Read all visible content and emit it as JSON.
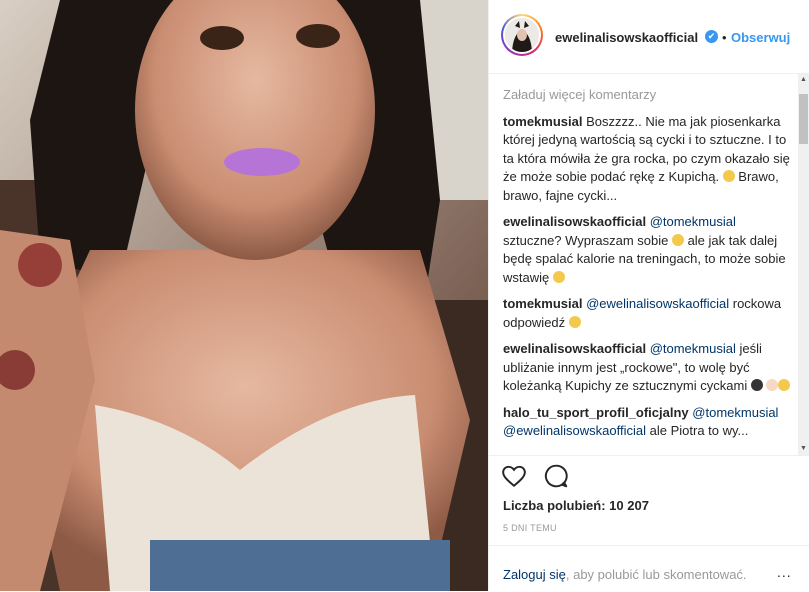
{
  "post": {
    "username": "ewelinalisowskaofficial",
    "verified_mark": "✔",
    "separator": "•",
    "follow_label": "Obserwuj"
  },
  "comments_section": {
    "load_more": "Załaduj więcej komentarzy",
    "comments": [
      {
        "author": "tomekmusial",
        "parts": [
          {
            "t": "Boszzzz.. Nie ma jak piosenkarka której jedyną wartością są cycki i to sztuczne. I to ta która mówiła że gra rocka, po czym okazało się że może sobie podać rękę z Kupichą. "
          },
          {
            "emoji": "clapping-hands-emoji",
            "color": "#f2c94c"
          },
          {
            "t": " Brawo, brawo, fajne cycki..."
          }
        ]
      },
      {
        "author": "ewelinalisowskaofficial",
        "parts": [
          {
            "mention": "@tomekmusial"
          },
          {
            "t": " sztuczne? Wypraszam sobie "
          },
          {
            "emoji": "laughing-emoji",
            "color": "#f2c94c"
          },
          {
            "t": " ale jak tak dalej będę spalać kalorie na treningach, to może sobie wstawię "
          },
          {
            "emoji": "winking-tongue-emoji",
            "color": "#f2c94c"
          }
        ]
      },
      {
        "author": "tomekmusial",
        "parts": [
          {
            "mention": "@ewelinalisowskaofficial"
          },
          {
            "t": " rockowa odpowiedź "
          },
          {
            "emoji": "eye-roll-emoji",
            "color": "#f2c94c"
          }
        ]
      },
      {
        "author": "ewelinalisowskaofficial",
        "parts": [
          {
            "mention": "@tomekmusial"
          },
          {
            "t": " jeśli ubliżanie innym jest „rockowe\", to wolę być koleżanką Kupichy ze sztucznymi cyckami "
          },
          {
            "emoji": "victory-hand-emoji",
            "color": "#333333"
          },
          {
            "t": " "
          },
          {
            "emoji": "skin-tone-emoji",
            "color": "#f5d9c4"
          },
          {
            "emoji": "sunglasses-emoji",
            "color": "#f2c94c"
          }
        ]
      },
      {
        "author": "halo_tu_sport_profil_oficjalny",
        "parts": [
          {
            "mention": "@tomekmusial"
          },
          {
            "t": " "
          },
          {
            "mention": "@ewelinalisowskaofficial"
          },
          {
            "t": " ale Piotra to wy..."
          }
        ]
      }
    ]
  },
  "actions": {
    "heart_icon": "heart-outline",
    "comment_icon": "speech-bubble-outline"
  },
  "likes_text": "Liczba polubień: 10 207",
  "timestamp": "5 DNI TEMU",
  "footer": {
    "login_label": "Zaloguj się",
    "prompt": ", aby polubić lub skomentować.",
    "more_label": "..."
  },
  "colors": {
    "link_blue": "#3897f0",
    "mention_dark": "#003569",
    "muted": "#999999",
    "text": "#262626"
  }
}
